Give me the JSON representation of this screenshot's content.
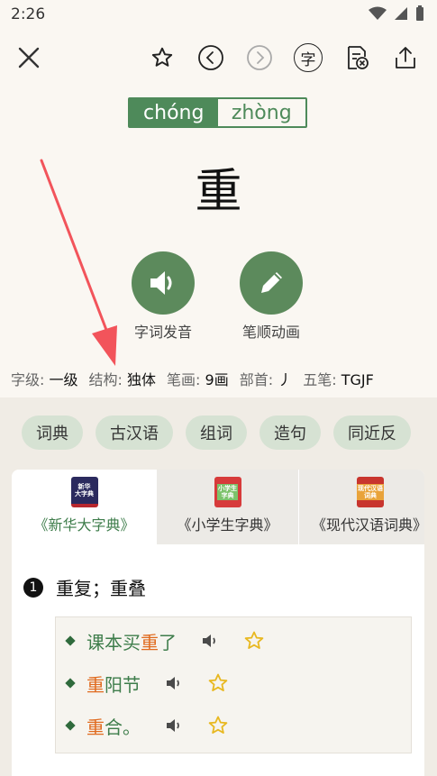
{
  "status": {
    "time": "2:26"
  },
  "toolbar": {
    "char_button": "字"
  },
  "pinyin": [
    {
      "label": "chóng",
      "active": true
    },
    {
      "label": "zhòng",
      "active": false
    }
  ],
  "character": "重",
  "actions": [
    {
      "label": "字词发音",
      "icon": "speaker-icon"
    },
    {
      "label": "笔顺动画",
      "icon": "pencil-icon"
    }
  ],
  "info": {
    "level_k": "字级:",
    "level_v": "一级",
    "struct_k": "结构:",
    "struct_v": "独体",
    "strokes_k": "笔画:",
    "strokes_v": "9画",
    "radical_k": "部首:",
    "radical_v": "丿",
    "wubi_k": "五笔:",
    "wubi_v": "TGJF"
  },
  "chips": [
    "词典",
    "古汉语",
    "组词",
    "造句",
    "同近反"
  ],
  "dict_tabs": [
    {
      "name": "《新华大字典》",
      "book_text": "新华\n大字典",
      "color": "#b8272e",
      "active": true
    },
    {
      "name": "《小学生字典》",
      "book_text": "小学生\n字典",
      "color": "#d73b3b",
      "active": false
    },
    {
      "name": "《现代汉语词典》",
      "book_text": "现代汉语\n词典",
      "color": "#c8352e",
      "active": false
    }
  ],
  "definition": {
    "number": "1",
    "text": "重复；重叠"
  },
  "examples": [
    {
      "pre": "课本买",
      "hl": "重",
      "post": "了"
    },
    {
      "pre": "",
      "hl": "重",
      "post": "阳节"
    },
    {
      "pre": "",
      "hl": "重",
      "post": "合。"
    }
  ],
  "colors": {
    "accent": "#4e8a5a",
    "highlight": "#e06a1e",
    "arrow": "#f2545b"
  }
}
